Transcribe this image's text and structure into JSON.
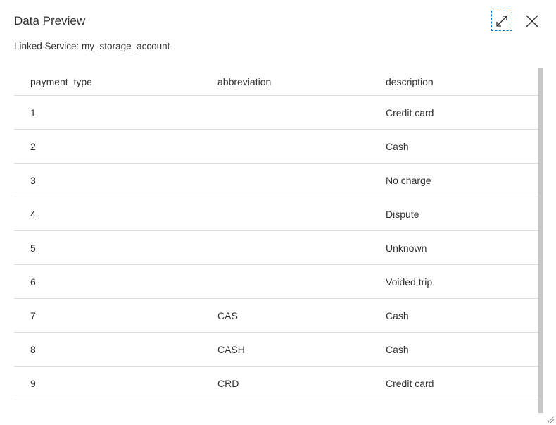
{
  "dialog": {
    "title": "Data Preview",
    "linked_service": "Linked Service: my_storage_account",
    "expand_icon": "expand-diagonal-icon",
    "close_icon": "close-icon"
  },
  "table": {
    "columns": [
      "payment_type",
      "abbreviation",
      "description"
    ],
    "rows": [
      [
        "1",
        "",
        "Credit card"
      ],
      [
        "2",
        "",
        "Cash"
      ],
      [
        "3",
        "",
        "No charge"
      ],
      [
        "4",
        "",
        "Dispute"
      ],
      [
        "5",
        "",
        "Unknown"
      ],
      [
        "6",
        "",
        "Voided trip"
      ],
      [
        "7",
        "CAS",
        "Cash"
      ],
      [
        "8",
        "CASH",
        "Cash"
      ],
      [
        "9",
        "CRD",
        "Credit card"
      ]
    ]
  },
  "colors": {
    "focus_outline": "#0078d4",
    "row_divider": "#e1dfdd",
    "scrollbar": "#c8c6c4"
  }
}
